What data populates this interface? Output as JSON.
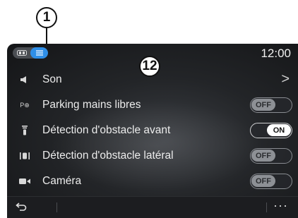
{
  "callouts": {
    "one": "1",
    "twelve": "12"
  },
  "status": {
    "time": "12:00"
  },
  "menu": {
    "items": [
      {
        "icon": "speaker-icon",
        "label": "Son",
        "control": "chevron",
        "chevron": ">"
      },
      {
        "icon": "parking-hands-free-icon",
        "icon_text": "P⊕",
        "label": "Parking mains libres",
        "control": "toggle",
        "state": "OFF"
      },
      {
        "icon": "front-obstacle-sensor-icon",
        "label": "Détection d'obstacle avant",
        "control": "toggle",
        "state": "ON"
      },
      {
        "icon": "side-obstacle-sensor-icon",
        "label": "Détection d'obstacle latéral",
        "control": "toggle",
        "state": "OFF"
      },
      {
        "icon": "camera-icon",
        "label": "Caméra",
        "control": "toggle",
        "state": "OFF"
      }
    ]
  },
  "bottom": {
    "more": "···"
  },
  "colors": {
    "accent": "#2f8fe8",
    "background": "#232528"
  }
}
